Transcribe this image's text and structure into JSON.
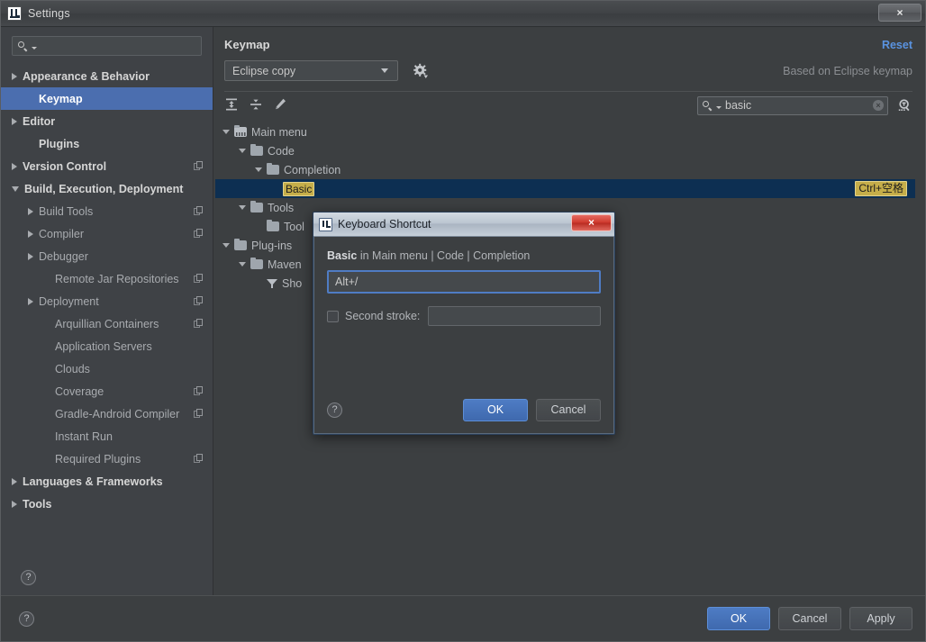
{
  "window": {
    "title": "Settings",
    "close_label": "×",
    "icon": "intellij-idea-icon"
  },
  "sidebar": {
    "search_placeholder": "",
    "search_value": "",
    "help_label": "?",
    "items": [
      {
        "label": "Appearance & Behavior",
        "indent": 0,
        "arrow": "right",
        "bold": true,
        "selected": false,
        "copy": false
      },
      {
        "label": "Keymap",
        "indent": 1,
        "arrow": "none",
        "bold": true,
        "selected": true,
        "copy": false
      },
      {
        "label": "Editor",
        "indent": 0,
        "arrow": "right",
        "bold": true,
        "selected": false,
        "copy": false
      },
      {
        "label": "Plugins",
        "indent": 1,
        "arrow": "none",
        "bold": true,
        "selected": false,
        "copy": false
      },
      {
        "label": "Version Control",
        "indent": 0,
        "arrow": "right",
        "bold": true,
        "selected": false,
        "copy": true
      },
      {
        "label": "Build, Execution, Deployment",
        "indent": 0,
        "arrow": "down",
        "bold": true,
        "selected": false,
        "copy": false
      },
      {
        "label": "Build Tools",
        "indent": 1,
        "arrow": "right",
        "bold": false,
        "selected": false,
        "copy": true
      },
      {
        "label": "Compiler",
        "indent": 1,
        "arrow": "right",
        "bold": false,
        "selected": false,
        "copy": true
      },
      {
        "label": "Debugger",
        "indent": 1,
        "arrow": "right",
        "bold": false,
        "selected": false,
        "copy": false
      },
      {
        "label": "Remote Jar Repositories",
        "indent": 2,
        "arrow": "none",
        "bold": false,
        "selected": false,
        "copy": true
      },
      {
        "label": "Deployment",
        "indent": 1,
        "arrow": "right",
        "bold": false,
        "selected": false,
        "copy": true
      },
      {
        "label": "Arquillian Containers",
        "indent": 2,
        "arrow": "none",
        "bold": false,
        "selected": false,
        "copy": true
      },
      {
        "label": "Application Servers",
        "indent": 2,
        "arrow": "none",
        "bold": false,
        "selected": false,
        "copy": false
      },
      {
        "label": "Clouds",
        "indent": 2,
        "arrow": "none",
        "bold": false,
        "selected": false,
        "copy": false
      },
      {
        "label": "Coverage",
        "indent": 2,
        "arrow": "none",
        "bold": false,
        "selected": false,
        "copy": true
      },
      {
        "label": "Gradle-Android Compiler",
        "indent": 2,
        "arrow": "none",
        "bold": false,
        "selected": false,
        "copy": true
      },
      {
        "label": "Instant Run",
        "indent": 2,
        "arrow": "none",
        "bold": false,
        "selected": false,
        "copy": false
      },
      {
        "label": "Required Plugins",
        "indent": 2,
        "arrow": "none",
        "bold": false,
        "selected": false,
        "copy": true
      },
      {
        "label": "Languages & Frameworks",
        "indent": 0,
        "arrow": "right",
        "bold": true,
        "selected": false,
        "copy": false
      },
      {
        "label": "Tools",
        "indent": 0,
        "arrow": "right",
        "bold": true,
        "selected": false,
        "copy": false
      }
    ]
  },
  "main": {
    "title": "Keymap",
    "reset_label": "Reset",
    "keymap_selected": "Eclipse copy",
    "gear_tooltip": "",
    "based_on": "Based on Eclipse keymap",
    "toolbar": {
      "expand_all": "expand-all-icon",
      "collapse_all": "collapse-all-icon",
      "edit": "edit-pencil-icon"
    },
    "search": {
      "value": "basic",
      "placeholder": "",
      "clear_label": "×"
    },
    "filter_icon": "find-shortcut-icon",
    "tree": [
      {
        "label": "Main menu",
        "indent": 0,
        "arrow": "down",
        "icon": "menu",
        "selected": false,
        "highlight": "",
        "shortcut": ""
      },
      {
        "label": "Code",
        "indent": 1,
        "arrow": "down",
        "icon": "folder",
        "selected": false,
        "highlight": "",
        "shortcut": ""
      },
      {
        "label": "Completion",
        "indent": 2,
        "arrow": "down",
        "icon": "folder",
        "selected": false,
        "highlight": "",
        "shortcut": ""
      },
      {
        "label": "",
        "indent": 3,
        "arrow": "none",
        "icon": "none",
        "selected": true,
        "highlight": "Basic",
        "shortcut": "Ctrl+空格"
      },
      {
        "label": "Tools",
        "indent": 1,
        "arrow": "down",
        "icon": "folder",
        "selected": false,
        "highlight": "",
        "shortcut": ""
      },
      {
        "label": "Tool",
        "indent": 2,
        "arrow": "none",
        "icon": "folder",
        "selected": false,
        "highlight": "",
        "shortcut": ""
      },
      {
        "label": "Plug-ins",
        "indent": 0,
        "arrow": "down",
        "icon": "folder",
        "selected": false,
        "highlight": "",
        "shortcut": ""
      },
      {
        "label": "Maven",
        "indent": 1,
        "arrow": "down",
        "icon": "folder",
        "selected": false,
        "highlight": "",
        "shortcut": ""
      },
      {
        "label": "Sho",
        "indent": 2,
        "arrow": "none",
        "icon": "funnel",
        "selected": false,
        "highlight": "",
        "shortcut": ""
      }
    ]
  },
  "bottom": {
    "help_label": "?",
    "ok_label": "OK",
    "cancel_label": "Cancel",
    "apply_label": "Apply"
  },
  "modal": {
    "title": "Keyboard Shortcut",
    "icon": "intellij-idea-icon",
    "close_label": "×",
    "description_action": "Basic",
    "description_rest": " in Main menu | Code | Completion",
    "first_stroke_value": "Alt+/",
    "second_stroke_label": "Second stroke:",
    "second_stroke_value": "",
    "second_stroke_checked": false,
    "help_label": "?",
    "ok_label": "OK",
    "cancel_label": "Cancel"
  },
  "colors": {
    "window_bg": "#3c3f41",
    "sidebar_bg": "#3f4246",
    "selection_blue": "#4b6eaf",
    "tree_selection": "#0d2f52",
    "highlight_yellow": "#c5ae4a",
    "link_blue": "#5a93e0",
    "primary_button": "#4478c9",
    "close_red": "#cf3a2e"
  }
}
